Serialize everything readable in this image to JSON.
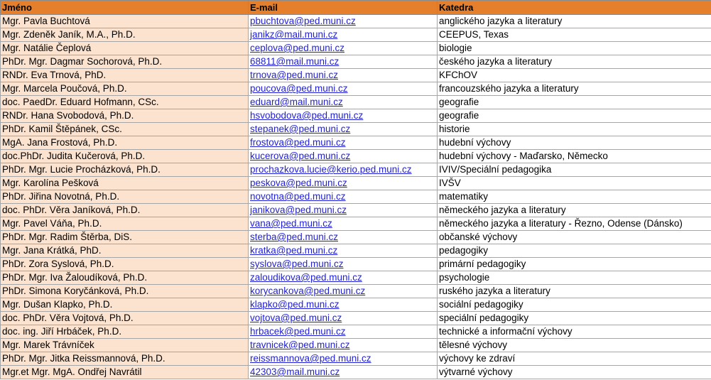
{
  "colors": {
    "header_bg": "#e57f2c",
    "name_cell_bg": "#fbe3cf",
    "link": "#1f1fd6"
  },
  "headers": {
    "name": "Jméno",
    "email": "E-mail",
    "dept": "Katedra"
  },
  "rows": [
    {
      "name": "Mgr. Pavla Buchtová",
      "email": "pbuchtova@ped.muni.cz",
      "dept": "anglického jazyka a literatury"
    },
    {
      "name": "Mgr. Zdeněk Janík, M.A., Ph.D.",
      "email": "janikz@mail.muni.cz",
      "dept": "CEEPUS, Texas"
    },
    {
      "name": "Mgr. Natálie Čeplová",
      "email": "ceplova@ped.muni.cz",
      "dept": "biologie"
    },
    {
      "name": "PhDr. Mgr. Dagmar Sochorová, Ph.D.",
      "email": "68811@mail.muni.cz",
      "dept": "českého jazyka a literatury"
    },
    {
      "name": "RNDr. Eva Trnová, PhD.",
      "email": "trnova@ped.muni.cz",
      "dept": "KFChOV"
    },
    {
      "name": "Mgr. Marcela Poučová, Ph.D.",
      "email": "poucova@ped.muni.cz",
      "dept": "francouzského jazyka a literatury"
    },
    {
      "name": "doc. PaedDr. Eduard Hofmann, CSc.",
      "email": "eduard@mail.muni.cz",
      "dept": "geografie"
    },
    {
      "name": "RNDr. Hana Svobodová, Ph.D.",
      "email": "hsvobodova@ped.muni.cz",
      "dept": "geografie"
    },
    {
      "name": "PhDr. Kamil Štěpánek, CSc.",
      "email": "stepanek@ped.muni.cz",
      "dept": "historie"
    },
    {
      "name": "MgA. Jana Frostová, Ph.D.",
      "email": "frostova@ped.muni.cz",
      "dept": "hudební výchovy"
    },
    {
      "name": "doc.PhDr. Judita Kučerová, Ph.D.",
      "email": "kucerova@ped.muni.cz",
      "dept": "hudební výchovy - Maďarsko, Německo"
    },
    {
      "name": "PhDr. Mgr. Lucie Procházková, Ph.D.",
      "email": "prochazkova.lucie@kerio.ped.muni.cz",
      "dept": "IVIV/Speciální pedagogika"
    },
    {
      "name": "Mgr. Karolína Pešková",
      "email": "peskova@ped.muni.cz",
      "dept": "IVŠV"
    },
    {
      "name": "PhDr. Jiřina Novotná, Ph.D.",
      "email": "novotna@ped.muni.cz",
      "dept": "matematiky"
    },
    {
      "name": "doc. PhDr. Věra Janíková, Ph.D.",
      "email": "janikova@ped.muni.cz",
      "dept": "německého jazyka a literatury"
    },
    {
      "name": "Mgr. Pavel Váňa, Ph.D.",
      "email": "vana@ped.muni.cz",
      "dept": "německého jazyka a literatury - Řezno, Odense (Dánsko)"
    },
    {
      "name": "PhDr. Mgr. Radim Štěrba, DiS.",
      "email": "sterba@ped.muni.cz",
      "dept": "občanské výchovy"
    },
    {
      "name": "Mgr. Jana Krátká, PhD.",
      "email": "kratka@ped.muni.cz",
      "dept": "pedagogiky"
    },
    {
      "name": "PhDr. Zora Syslová, Ph.D.",
      "email": "syslova@ped.muni.cz",
      "dept": "primární pedagogiky"
    },
    {
      "name": "PhDr. Mgr. Iva Žaloudíková, Ph.D.",
      "email": "zaloudikova@ped.muni.cz",
      "dept": "psychologie"
    },
    {
      "name": "PhDr. Simona Koryčánková, Ph.D.",
      "email": "korycankova@ped.muni.cz",
      "dept": "ruského jazyka a literatury"
    },
    {
      "name": "Mgr. Dušan Klapko, Ph.D.",
      "email": "klapko@ped.muni.cz",
      "dept": "sociální pedagogiky"
    },
    {
      "name": "doc. PhDr. Věra Vojtová, Ph.D.",
      "email": "vojtova@ped.muni.cz",
      "dept": "speciální pedagogiky"
    },
    {
      "name": "doc. ing. Jiří Hrbáček, Ph.D.",
      "email": "hrbacek@ped.muni.cz",
      "dept": "technické a informační výchovy"
    },
    {
      "name": "Mgr. Marek Trávníček",
      "email": "travnicek@ped.muni.cz",
      "dept": "tělesné výchovy"
    },
    {
      "name": "PhDr. Mgr. Jitka Reissmannová, Ph.D.",
      "email": "reissmannova@ped.muni.cz",
      "dept": "výchovy ke zdraví"
    },
    {
      "name": "Mgr.et Mgr. MgA. Ondřej Navrátil",
      "email": "42303@mail.muni.cz",
      "dept": "výtvarné výchovy"
    }
  ]
}
